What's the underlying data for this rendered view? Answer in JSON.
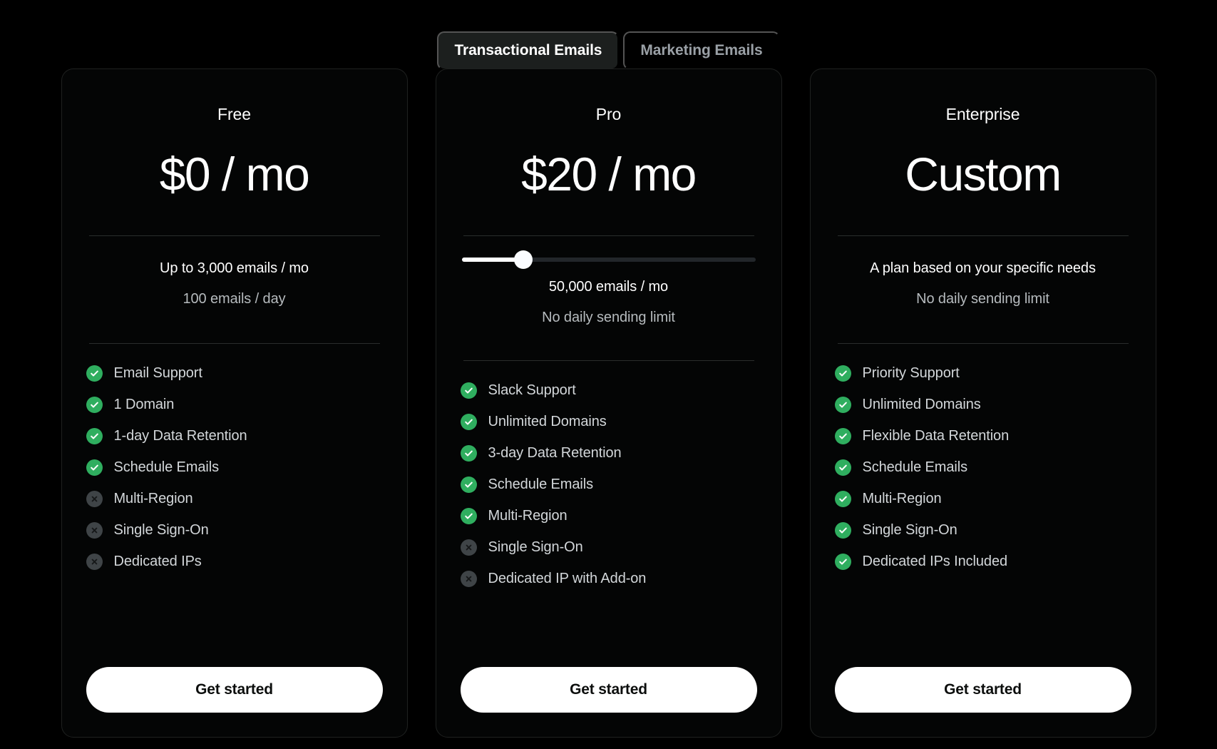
{
  "colors": {
    "page_background": "#000000",
    "card_background": "#040505",
    "card_border": "#1f2120",
    "tab_active_background": "#1c1f1e",
    "check_green": "#2fae5f",
    "cross_gray": "#3f4447",
    "cta_background": "#ffffff",
    "slider_fill": "#ffffff",
    "slider_track": "#22262a"
  },
  "tabs": [
    {
      "label": "Transactional Emails",
      "active": true
    },
    {
      "label": "Marketing Emails",
      "active": false
    }
  ],
  "plans": [
    {
      "name": "Free",
      "price": "$0 / mo",
      "quota_primary": "Up to 3,000 emails / mo",
      "quota_secondary": "100 emails / day",
      "has_slider": false,
      "features": [
        {
          "icon": "check-circle-icon",
          "included": true,
          "label": "Email Support"
        },
        {
          "icon": "check-circle-icon",
          "included": true,
          "label": "1 Domain"
        },
        {
          "icon": "check-circle-icon",
          "included": true,
          "label": "1-day Data Retention"
        },
        {
          "icon": "check-circle-icon",
          "included": true,
          "label": "Schedule Emails"
        },
        {
          "icon": "cross-circle-icon",
          "included": false,
          "label": "Multi-Region"
        },
        {
          "icon": "cross-circle-icon",
          "included": false,
          "label": "Single Sign-On"
        },
        {
          "icon": "cross-circle-icon",
          "included": false,
          "label": "Dedicated IPs"
        }
      ],
      "cta_label": "Get started"
    },
    {
      "name": "Pro",
      "price": "$20 / mo",
      "quota_primary": "50,000 emails / mo",
      "quota_secondary": "No daily sending limit",
      "has_slider": true,
      "slider_percent": 21,
      "features": [
        {
          "icon": "check-circle-icon",
          "included": true,
          "label": "Slack Support"
        },
        {
          "icon": "check-circle-icon",
          "included": true,
          "label": "Unlimited Domains"
        },
        {
          "icon": "check-circle-icon",
          "included": true,
          "label": "3-day Data Retention"
        },
        {
          "icon": "check-circle-icon",
          "included": true,
          "label": "Schedule Emails"
        },
        {
          "icon": "check-circle-icon",
          "included": true,
          "label": "Multi-Region"
        },
        {
          "icon": "cross-circle-icon",
          "included": false,
          "label": "Single Sign-On"
        },
        {
          "icon": "cross-circle-icon",
          "included": false,
          "label": "Dedicated IP with Add-on"
        }
      ],
      "cta_label": "Get started"
    },
    {
      "name": "Enterprise",
      "price": "Custom",
      "quota_primary": "A plan based on your specific needs",
      "quota_secondary": "No daily sending limit",
      "has_slider": false,
      "features": [
        {
          "icon": "check-circle-icon",
          "included": true,
          "label": "Priority Support"
        },
        {
          "icon": "check-circle-icon",
          "included": true,
          "label": "Unlimited Domains"
        },
        {
          "icon": "check-circle-icon",
          "included": true,
          "label": "Flexible Data Retention"
        },
        {
          "icon": "check-circle-icon",
          "included": true,
          "label": "Schedule Emails"
        },
        {
          "icon": "check-circle-icon",
          "included": true,
          "label": "Multi-Region"
        },
        {
          "icon": "check-circle-icon",
          "included": true,
          "label": "Single Sign-On"
        },
        {
          "icon": "check-circle-icon",
          "included": true,
          "label": "Dedicated IPs Included"
        }
      ],
      "cta_label": "Get started"
    }
  ]
}
